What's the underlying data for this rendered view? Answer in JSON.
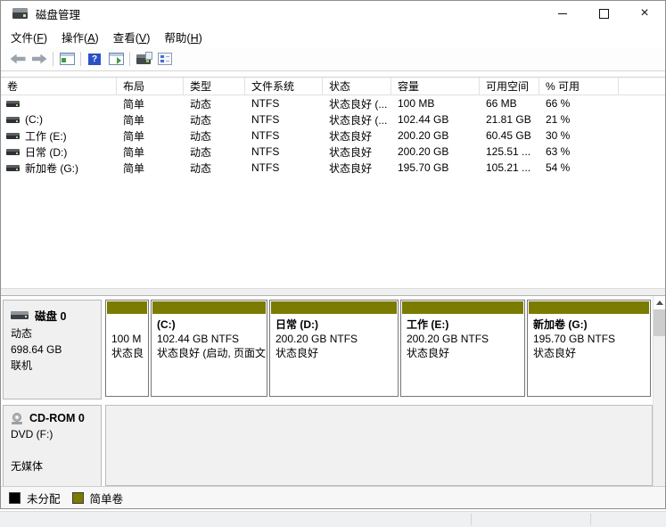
{
  "window": {
    "title": "磁盘管理",
    "close_glyph": "×"
  },
  "menu_bar": {
    "items": [
      {
        "label": "文件",
        "key": "F"
      },
      {
        "label": "操作",
        "key": "A"
      },
      {
        "label": "查看",
        "key": "V"
      },
      {
        "label": "帮助",
        "key": "H"
      }
    ]
  },
  "toolbar": {
    "help_glyph": "?",
    "icons": [
      "back",
      "forward",
      "separator",
      "show-console-tree",
      "separator",
      "help",
      "show-action-pane",
      "separator",
      "disk-popup",
      "properties-checklist"
    ]
  },
  "volume_table": {
    "columns": [
      "卷",
      "布局",
      "类型",
      "文件系统",
      "状态",
      "容量",
      "可用空间",
      "% 可用"
    ],
    "rows": [
      {
        "name": "",
        "layout": "简单",
        "type": "动态",
        "fs": "NTFS",
        "status": "状态良好 (...",
        "capacity": "100 MB",
        "free": "66 MB",
        "pct_free": "66 %"
      },
      {
        "name": "(C:)",
        "layout": "简单",
        "type": "动态",
        "fs": "NTFS",
        "status": "状态良好 (...",
        "capacity": "102.44 GB",
        "free": "21.81 GB",
        "pct_free": "21 %"
      },
      {
        "name": "工作 (E:)",
        "layout": "简单",
        "type": "动态",
        "fs": "NTFS",
        "status": "状态良好",
        "capacity": "200.20 GB",
        "free": "60.45 GB",
        "pct_free": "30 %"
      },
      {
        "name": "日常 (D:)",
        "layout": "简单",
        "type": "动态",
        "fs": "NTFS",
        "status": "状态良好",
        "capacity": "200.20 GB",
        "free": "125.51 ...",
        "pct_free": "63 %"
      },
      {
        "name": "新加卷 (G:)",
        "layout": "简单",
        "type": "动态",
        "fs": "NTFS",
        "status": "状态良好",
        "capacity": "195.70 GB",
        "free": "105.21 ...",
        "pct_free": "54 %"
      }
    ]
  },
  "disk0": {
    "name": "磁盘 0",
    "type": "动态",
    "size": "698.64 GB",
    "status": "联机",
    "partitions": [
      {
        "name": "",
        "info": "100 M",
        "status": "状态良"
      },
      {
        "name": "(C:)",
        "info": "102.44 GB NTFS",
        "status": "状态良好 (启动, 页面文"
      },
      {
        "name": "日常  (D:)",
        "info": "200.20 GB NTFS",
        "status": "状态良好"
      },
      {
        "name": "工作  (E:)",
        "info": "200.20 GB NTFS",
        "status": "状态良好"
      },
      {
        "name": "新加卷  (G:)",
        "info": "195.70 GB NTFS",
        "status": "状态良好"
      }
    ]
  },
  "cdrom": {
    "name": "CD-ROM 0",
    "drive": "DVD (F:)",
    "media": "无媒体"
  },
  "legend": {
    "items": [
      {
        "label": "未分配",
        "color": "#000000"
      },
      {
        "label": "简单卷",
        "color": "#7b7b00"
      }
    ]
  },
  "colors": {
    "simple_volume": "#7b7b00",
    "unallocated": "#000000"
  }
}
